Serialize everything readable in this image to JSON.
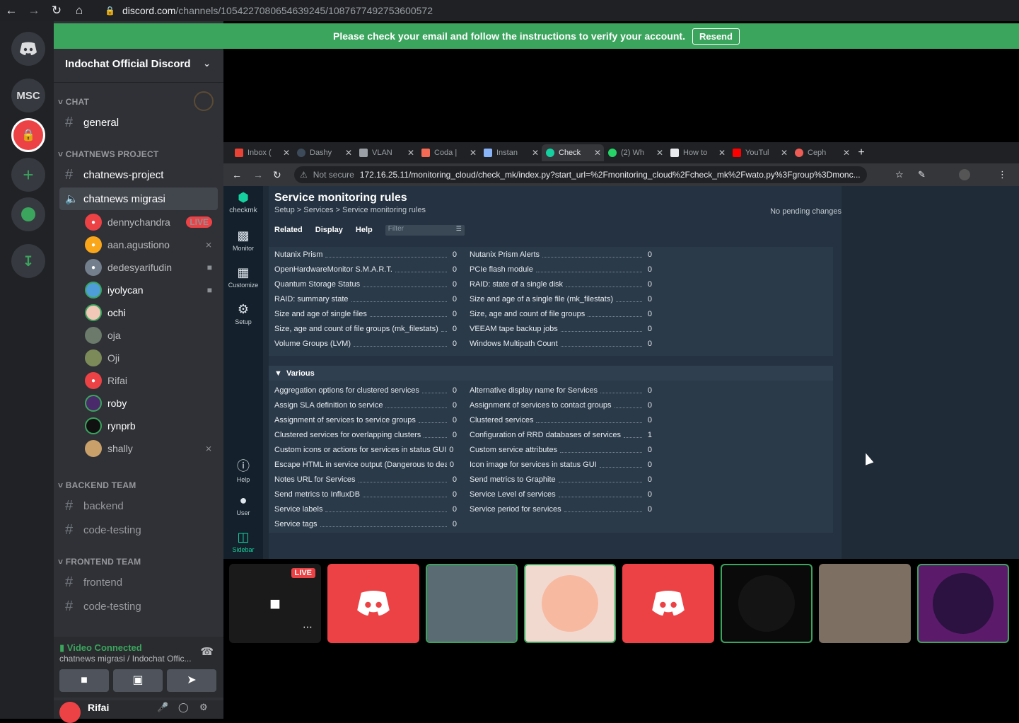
{
  "browser": {
    "url_host": "discord.com",
    "url_path": "/channels/1054227080654639245/1087677492753600572"
  },
  "banner": {
    "text": "Please check your email and follow the instructions to verify your account.",
    "button": "Resend"
  },
  "rail": {
    "msc_label": "MSC"
  },
  "server": {
    "name": "Indochat Official Discord",
    "categories": {
      "chat": "CHAT",
      "chatnews_project": "CHATNEWS PROJECT",
      "backend": "BACKEND TEAM",
      "frontend": "FRONTEND TEAM"
    },
    "channels": {
      "general": "general",
      "chatnews_project": "chatnews-project",
      "chatnews_migrasi": "chatnews migrasi",
      "backend": "backend",
      "backend_code_testing": "code-testing",
      "frontend": "frontend",
      "frontend_code_testing": "code-testing"
    },
    "voice_users": [
      {
        "name": "dennychandra",
        "badge": "LIVE"
      },
      {
        "name": "aan.agustiono"
      },
      {
        "name": "dedesyarifudin"
      },
      {
        "name": "iyolycan"
      },
      {
        "name": "ochi"
      },
      {
        "name": "oja"
      },
      {
        "name": "Oji"
      },
      {
        "name": "Rifai"
      },
      {
        "name": "roby"
      },
      {
        "name": "rynprb"
      },
      {
        "name": "shally"
      }
    ],
    "vc_status": "Video Connected",
    "vc_location": "chatnews migrasi / Indochat Offic...",
    "user_name": "Rifai"
  },
  "inner_browser": {
    "tabs": [
      "Inbox (",
      "Dashy",
      "VLAN",
      "Coda |",
      "Instan",
      "Check",
      "(2) Wh",
      "How to",
      "YouTul",
      "Ceph"
    ],
    "not_secure": "Not secure",
    "url": "172.16.25.11/monitoring_cloud/check_mk/index.py?start_url=%2Fmonitoring_cloud%2Fcheck_mk%2Fwato.py%3Fgroup%3Dmonc..."
  },
  "checkmk": {
    "logo": "checkmk",
    "nav": [
      "Monitor",
      "Customize",
      "Setup",
      "Help",
      "User",
      "Sidebar"
    ],
    "title": "Service monitoring rules",
    "breadcrumb": "Setup > Services > Service monitoring rules",
    "pending": "No pending changes",
    "menu": [
      "Related",
      "Display",
      "Help"
    ],
    "filter_placeholder": "Filter",
    "top_rules_left": [
      {
        "name": "Nutanix Prism",
        "count": "0"
      },
      {
        "name": "OpenHardwareMonitor S.M.A.R.T.",
        "count": "0"
      },
      {
        "name": "Quantum Storage Status",
        "count": "0"
      },
      {
        "name": "RAID: summary state",
        "count": "0"
      },
      {
        "name": "Size and age of single files",
        "count": "0"
      },
      {
        "name": "Size, age and count of file groups (mk_filestats)",
        "count": "0"
      },
      {
        "name": "Volume Groups (LVM)",
        "count": "0"
      }
    ],
    "top_rules_right": [
      {
        "name": "Nutanix Prism Alerts",
        "count": "0"
      },
      {
        "name": "PCIe flash module",
        "count": "0"
      },
      {
        "name": "RAID: state of a single disk",
        "count": "0"
      },
      {
        "name": "Size and age of a single file (mk_filestats)",
        "count": "0"
      },
      {
        "name": "Size, age and count of file groups",
        "count": "0"
      },
      {
        "name": "VEEAM tape backup jobs",
        "count": "0"
      },
      {
        "name": "Windows Multipath Count",
        "count": "0"
      }
    ],
    "various_title": "Various",
    "various_left": [
      {
        "name": "Aggregation options for clustered services",
        "count": "0"
      },
      {
        "name": "Assign SLA definition to service",
        "count": "0"
      },
      {
        "name": "Assignment of services to service groups",
        "count": "0"
      },
      {
        "name": "Clustered services for overlapping clusters",
        "count": "0"
      },
      {
        "name": "Custom icons or actions for services in status GUI",
        "count": "0"
      },
      {
        "name": "Escape HTML in service output (Dangerous to deactivate - read help)",
        "count": "0"
      },
      {
        "name": "Notes URL for Services",
        "count": "0"
      },
      {
        "name": "Send metrics to InfluxDB",
        "count": "0"
      },
      {
        "name": "Service labels",
        "count": "0"
      },
      {
        "name": "Service tags",
        "count": "0"
      }
    ],
    "various_right": [
      {
        "name": "Alternative display name for Services",
        "count": "0"
      },
      {
        "name": "Assignment of services to contact groups",
        "count": "0"
      },
      {
        "name": "Clustered services",
        "count": "0"
      },
      {
        "name": "Configuration of RRD databases of services",
        "count": "1"
      },
      {
        "name": "Custom service attributes",
        "count": "0"
      },
      {
        "name": "Icon image for services in status GUI",
        "count": "0"
      },
      {
        "name": "Send metrics to Graphite",
        "count": "0"
      },
      {
        "name": "Service Level of services",
        "count": "0"
      },
      {
        "name": "Service period for services",
        "count": "0"
      }
    ]
  },
  "video_tiles": {
    "live_badge": "LIVE"
  },
  "colors": {
    "discord_red": "#ed4245",
    "discord_green": "#3ba55d",
    "rail_bg": "#202225",
    "channel_bg": "#2f3136"
  }
}
